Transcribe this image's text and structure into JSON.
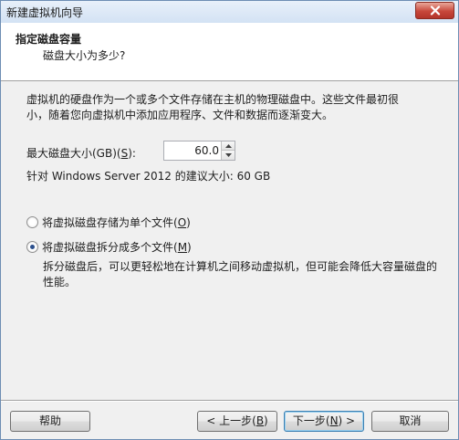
{
  "window": {
    "title": "新建虚拟机向导"
  },
  "header": {
    "title": "指定磁盘容量",
    "subtitle": "磁盘大小为多少?"
  },
  "description": {
    "line1": "虚拟机的硬盘作为一个或多个文件存储在主机的物理磁盘中。这些文件最初很",
    "line2": "小，随着您向虚拟机中添加应用程序、文件和数据而逐渐变大。"
  },
  "disk_size": {
    "label_prefix": "最大磁盘大小(GB)(",
    "label_key": "S",
    "label_suffix": "):",
    "value": "60.0",
    "recommendation": "针对 Windows Server 2012 的建议大小: 60 GB"
  },
  "options": {
    "single_file": {
      "label_prefix": "将虚拟磁盘存储为单个文件(",
      "label_key": "O",
      "label_suffix": ")",
      "checked": false
    },
    "multi_file": {
      "label_prefix": "将虚拟磁盘拆分成多个文件(",
      "label_key": "M",
      "label_suffix": ")",
      "checked": true,
      "desc_line1": "拆分磁盘后，可以更轻松地在计算机之间移动虚拟机，但可能会降低大容量磁盘的",
      "desc_line2": "性能。"
    }
  },
  "buttons": {
    "help": "帮助",
    "back_prefix": "< 上一步(",
    "back_key": "B",
    "back_suffix": ")",
    "next_prefix": "下一步(",
    "next_key": "N",
    "next_suffix": ") >",
    "cancel": "取消"
  }
}
